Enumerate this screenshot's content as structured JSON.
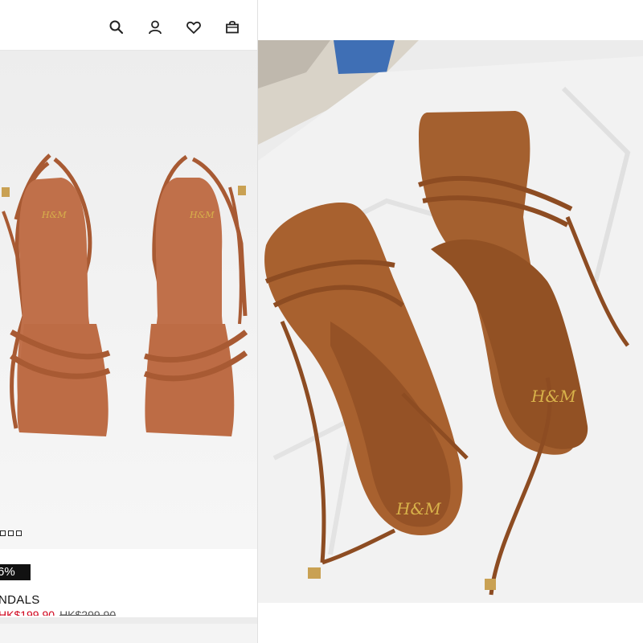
{
  "nav": {
    "icons": [
      "search-icon",
      "account-icon",
      "wishlist-heart-icon",
      "shopping-bag-icon"
    ]
  },
  "product": {
    "discount": "6%",
    "name": "NDALS",
    "price_sale": "HK$199.90",
    "price_original": "HK$299.90",
    "swatch_count": 3
  },
  "colors": {
    "leather": "#b8683f",
    "leather_dark": "#8a4a26",
    "photo_leather": "#a8612f",
    "sale_red": "#d0021b",
    "badge_black": "#111111"
  },
  "brand": {
    "logo": "H&M"
  }
}
